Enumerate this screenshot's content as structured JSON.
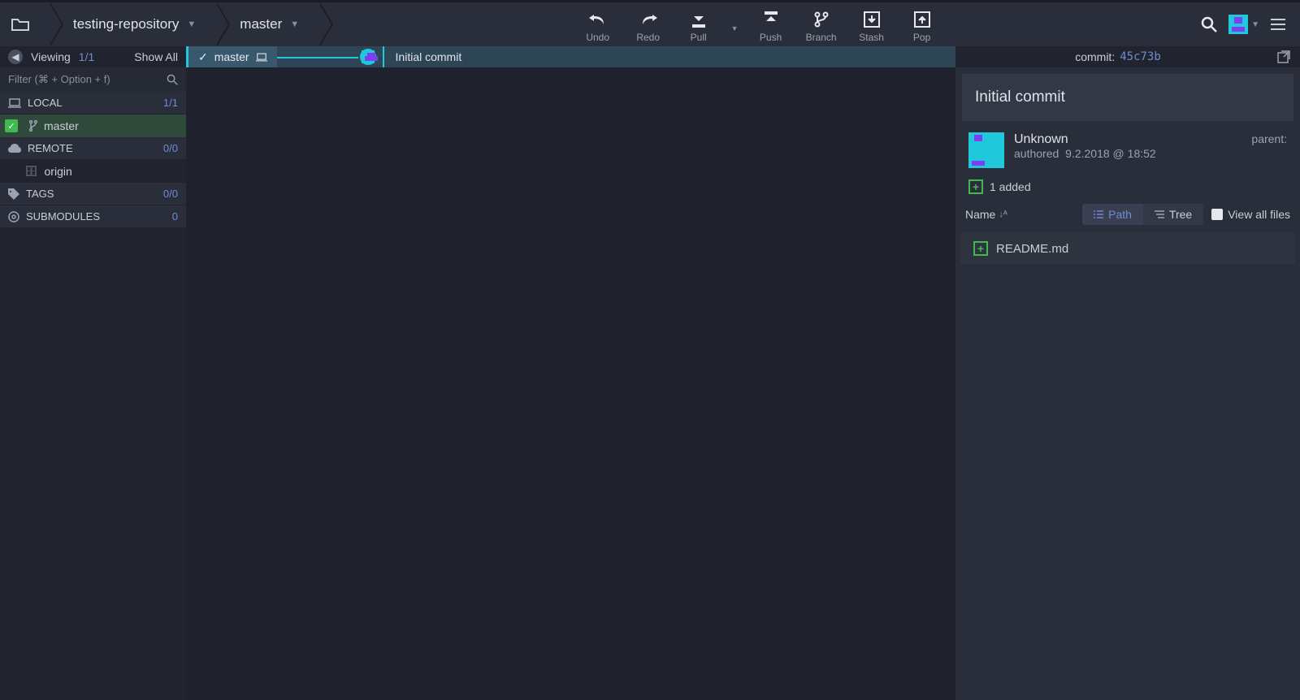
{
  "toolbar": {
    "repo": "testing-repository",
    "branch": "master",
    "buttons": {
      "undo": "Undo",
      "redo": "Redo",
      "pull": "Pull",
      "push": "Push",
      "branch": "Branch",
      "stash": "Stash",
      "pop": "Pop"
    }
  },
  "sidebar": {
    "viewing": "Viewing",
    "viewing_count": "1/1",
    "show_all": "Show All",
    "filter_placeholder": "Filter (⌘ + Option + f)",
    "sections": {
      "local": {
        "label": "LOCAL",
        "count": "1/1"
      },
      "remote": {
        "label": "REMOTE",
        "count": "0/0"
      },
      "tags": {
        "label": "TAGS",
        "count": "0/0"
      },
      "submodules": {
        "label": "SUBMODULES",
        "count": "0"
      }
    },
    "local_branch": "master",
    "remote_name": "origin"
  },
  "graph": {
    "branch_label": "master",
    "commit_message": "Initial commit"
  },
  "details": {
    "commit_label": "commit:",
    "commit_hash": "45c73b",
    "title": "Initial commit",
    "author": "Unknown",
    "authored_label": "authored",
    "authored_date": "9.2.2018 @ 18:52",
    "parent_label": "parent:",
    "added_count": "1 added",
    "name_label": "Name",
    "path_label": "Path",
    "tree_label": "Tree",
    "view_all": "View all files",
    "file": "README.md"
  }
}
